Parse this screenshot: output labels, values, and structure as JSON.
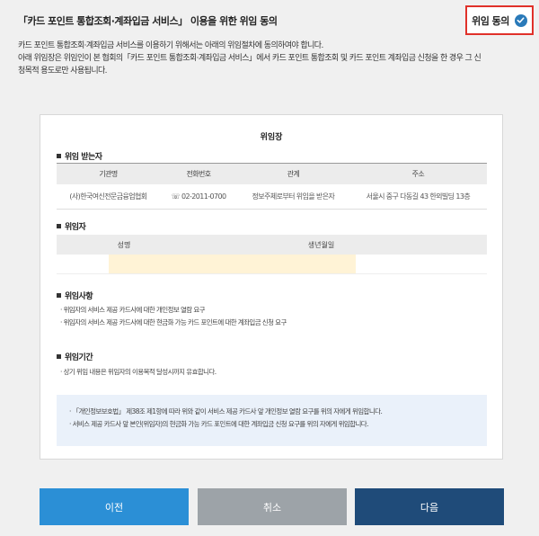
{
  "header": {
    "title": "「카드 포인트 통합조회·계좌입금 서비스」 이용을 위한 위임 동의",
    "consent_label": "위임 동의",
    "consent_icon": "check-circle-icon",
    "consent_checked": true
  },
  "intro": {
    "line1": "카드 포인트 통합조회·계좌입금 서비스를 이용하기 위해서는 아래의 위임절차에 동의하여야 합니다.",
    "line2": "아래 위임장은 위임인이 본 협회의「카드 포인트 통합조회·계좌입금 서비스」에서 카드 포인트 통합조회 및 카드 포인트 계좌입금 신청을 한 경우 그 신",
    "line3": "청목적 용도로만 사용됩니다."
  },
  "document": {
    "title": "위임장",
    "delegate": {
      "section_title": "위임 받는자",
      "headers": [
        "기관명",
        "전화번호",
        "관계",
        "주소"
      ],
      "row": {
        "org": "(사)한국여신전문금융업협회",
        "phone": "☏ 02-2011-0700",
        "relation": "정보주체로부터 위임을 받은자",
        "address": "서울시 중구 다동길 43 한외빌딩 13층"
      }
    },
    "delegator": {
      "section_title": "위임자",
      "headers": [
        "성명",
        "생년월일"
      ],
      "name": "",
      "birthdate": ""
    },
    "matters": {
      "section_title": "위임사항",
      "items": [
        "· 위임자의 서비스 제공 카드사에 대한 개인정보 열람 요구",
        "· 위임자의 서비스 제공 카드사에 대한 현금화 가능 카드 포인트에 대한 계좌입금 신청 요구"
      ]
    },
    "period": {
      "section_title": "위임기간",
      "items": [
        "· 상기 위임 내용은 위임자의 이용목적 달성시까지 유효합니다."
      ]
    },
    "notice": [
      "· 「개인정보보호법」 제38조 제1항에 따라 위와 같이 서비스 제공 카드사 앞 개인정보 열람 요구를 위의 자에게 위임합니다.",
      "· 서비스 제공 카드사 앞 본인(위임자)의 현금화 가능 카드 포인트에 대한 계좌입금 신청 요구를 위의 자에게 위임합니다."
    ]
  },
  "buttons": {
    "prev": "이전",
    "cancel": "취소",
    "next": "다음"
  },
  "colors": {
    "consent_border": "#e0312a",
    "check": "#2a7ab9",
    "prev": "#2b8fd6",
    "cancel": "#9da3a8",
    "next": "#1f4b79",
    "input_fill": "#fff3d6",
    "notice_bg": "#eaf1fa"
  }
}
